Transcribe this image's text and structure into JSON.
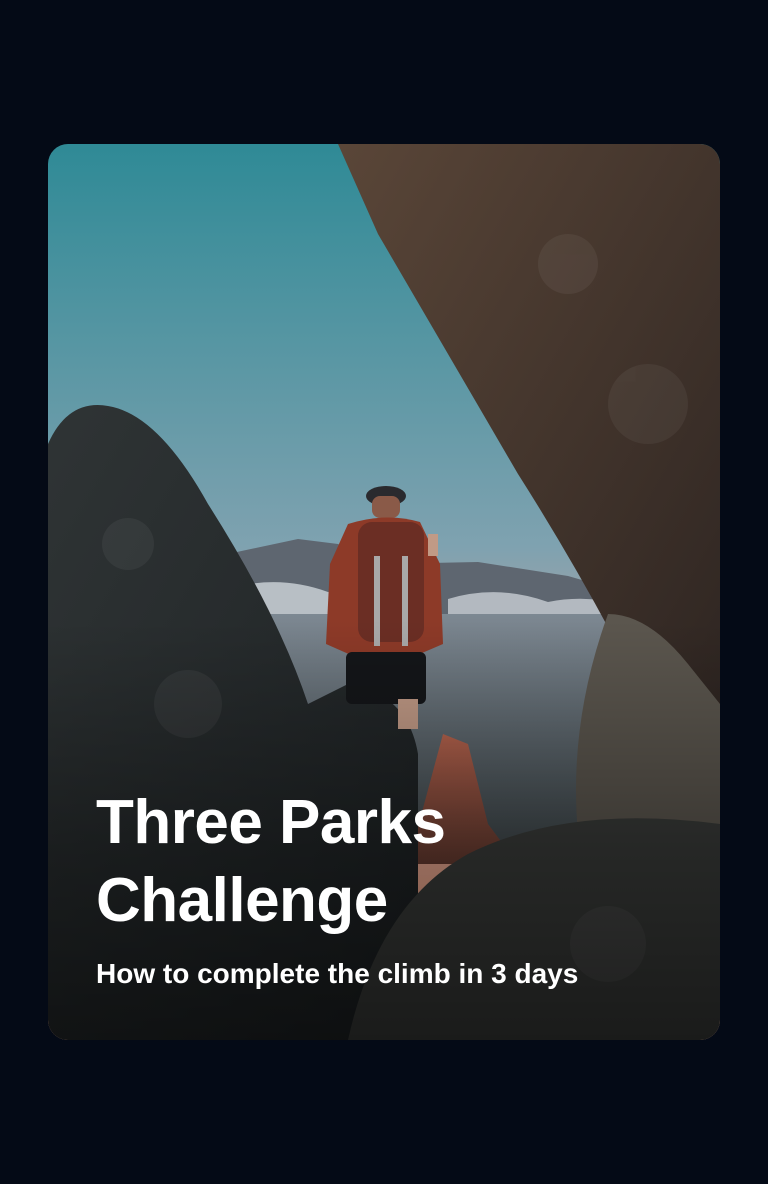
{
  "card": {
    "title": "Three Parks Challenge",
    "subtitle": "How to complete the climb in 3 days",
    "image": "hiker-with-backpack-between-rocks-photo"
  },
  "colors": {
    "page_background": "#040a16",
    "text": "#ffffff",
    "sky_top": "#2f8a96",
    "sky_bottom": "#e8a88e",
    "rock": "#3a3c3a"
  }
}
